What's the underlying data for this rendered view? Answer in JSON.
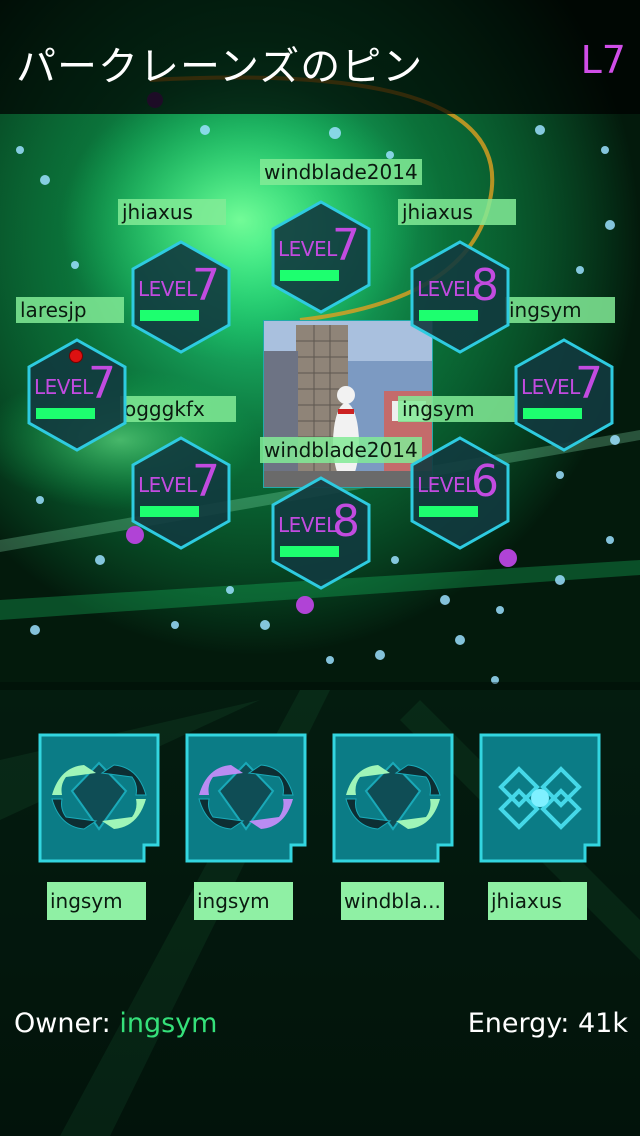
{
  "header": {
    "portal_name": "パークレーンズのピン",
    "portal_level": "L7"
  },
  "resonators": [
    {
      "id": "n",
      "level_label": "LEVEL",
      "level": "7",
      "owner": "windblade2014",
      "energy": 0.9
    },
    {
      "id": "nw",
      "level_label": "LEVEL",
      "level": "7",
      "owner": "jhiaxus",
      "energy": 0.9
    },
    {
      "id": "ne",
      "level_label": "LEVEL",
      "level": "8",
      "owner": "jhiaxus",
      "energy": 0.9
    },
    {
      "id": "w",
      "level_label": "LEVEL",
      "level": "7",
      "owner": "laresjp",
      "energy": 0.9
    },
    {
      "id": "e",
      "level_label": "LEVEL",
      "level": "7",
      "owner": "ingsym",
      "energy": 0.9
    },
    {
      "id": "sw",
      "level_label": "LEVEL",
      "level": "7",
      "owner": "ogggkfx",
      "energy": 0.9
    },
    {
      "id": "se",
      "level_label": "LEVEL",
      "level": "6",
      "owner": "ingsym",
      "energy": 0.9
    },
    {
      "id": "s",
      "level_label": "LEVEL",
      "level": "8",
      "owner": "windblade2014",
      "energy": 0.9
    }
  ],
  "mods": [
    {
      "owner": "ingsym",
      "icon": "shield-mod-icon",
      "color": "#9ff5b8"
    },
    {
      "owner": "ingsym",
      "icon": "shield-mod-icon",
      "color": "#b98cf2"
    },
    {
      "owner": "windbla...",
      "icon": "shield-mod-icon",
      "color": "#9ff5b8"
    },
    {
      "owner": "jhiaxus",
      "icon": "multi-hack-mod-icon",
      "color": "#45d8e8"
    }
  ],
  "footer": {
    "owner_label": "Owner:",
    "owner_name": "ingsym",
    "energy_label": "Energy:",
    "energy_value": "41k"
  },
  "colors": {
    "level_purple": "#c24be0",
    "energy_green": "#1dff6f",
    "tile_teal": "#0b7c86",
    "tile_border": "#33d6e0"
  }
}
